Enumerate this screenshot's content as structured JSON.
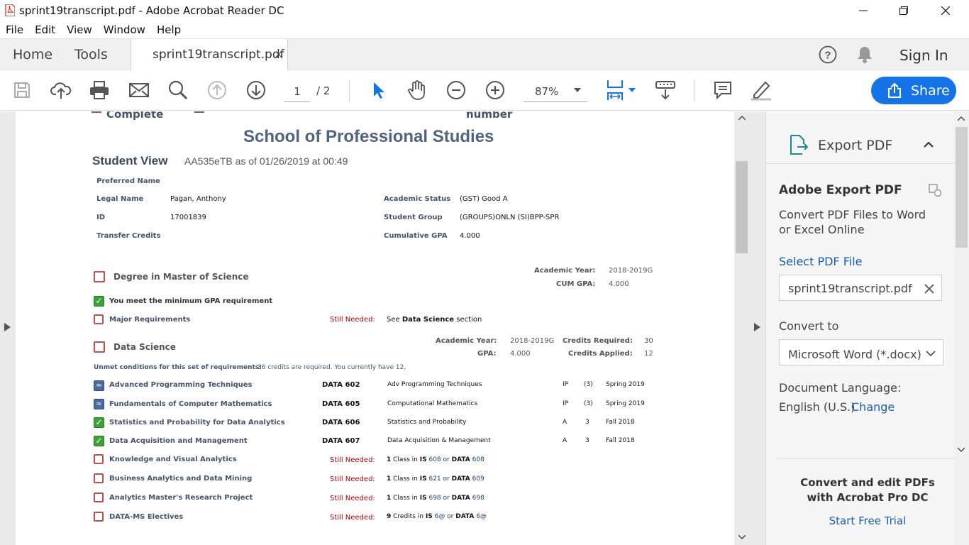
{
  "window": {
    "title": "sprint19transcript.pdf - Adobe Acrobat Reader DC",
    "minimize": "—",
    "maximize": "❐",
    "close": "✕"
  },
  "menu": [
    "File",
    "Edit",
    "View",
    "Window",
    "Help"
  ],
  "tabs": {
    "home": "Home",
    "tools": "Tools",
    "doc": "sprint19transcript.pdf",
    "doc_close": "×",
    "signin": "Sign In",
    "help_icon": "?"
  },
  "toolbar": {
    "page_current": "1",
    "page_total": "/ 2",
    "zoom": "87%",
    "share": "Share"
  },
  "document": {
    "cut_top_left": "Complete",
    "cut_top_right": "number",
    "school": "School of Professional Studies",
    "view_title": "Student View",
    "view_sub": "AA535eTB as of 01/26/2019 at 00:49",
    "info": {
      "preferred_name_label": "Preferred Name",
      "legal_name_label": "Legal Name",
      "legal_name": "Pagan, Anthony",
      "id_label": "ID",
      "id": "17001839",
      "transfer_label": "Transfer Credits",
      "status_label": "Academic Status",
      "status": "(GST) Good A",
      "group_label": "Student Group",
      "group": "(GROUPS)ONLN (SI)BPP-SPR",
      "gpa_label": "Cumulative GPA",
      "gpa": "4.000"
    },
    "degree": {
      "title": "Degree in Master of Science",
      "ay_label": "Academic Year:",
      "ay": "2018-2019G",
      "cumgpa_label": "CUM GPA:",
      "cumgpa": "4.000",
      "gpa_req": "You meet the minimum GPA requirement",
      "major": "Major Requirements",
      "still_needed": "Still Needed:",
      "major_note_pre": "See",
      "major_note_bold": "Data Science",
      "major_note_post": "section"
    },
    "ds": {
      "title": "Data Science",
      "ay_label": "Academic Year:",
      "ay": "2018-2019G",
      "gpa_label": "GPA:",
      "gpa": "4.000",
      "cr_req_label": "Credits Required:",
      "cr_req": "30",
      "cr_app_label": "Credits Applied:",
      "cr_app": "12",
      "unmet_label": "Unmet conditions for this set of requirements:",
      "unmet_text": "36 credits are required. You currently have 12,"
    },
    "courses": [
      {
        "name": "Advanced Programming Techniques",
        "code": "DATA 602",
        "title": "Adv Programming Techniques",
        "grade": "IP",
        "cr": "(3)",
        "term": "Spring 2019",
        "state": "ip"
      },
      {
        "name": "Fundamentals of Computer Mathematics",
        "code": "DATA 605",
        "title": "Computational Mathematics",
        "grade": "IP",
        "cr": "(3)",
        "term": "Spring 2019",
        "state": "ip"
      },
      {
        "name": "Statistics and Probability for Data Analytics",
        "code": "DATA 606",
        "title": "Statistics and Probability",
        "grade": "A",
        "cr": "3",
        "term": "Fall 2018",
        "state": "done"
      },
      {
        "name": "Data Acquisition and Management",
        "code": "DATA 607",
        "title": "Data Acquisition & Management",
        "grade": "A",
        "cr": "3",
        "term": "Fall 2018",
        "state": "done"
      }
    ],
    "needed": [
      {
        "name": "Knowledge and Visual Analytics",
        "sn": "Still Needed:",
        "n": "1",
        "txt1": "Class in",
        "s1": "IS",
        "v1": "608 or",
        "s2": "DATA",
        "v2": "608"
      },
      {
        "name": "Business Analytics and Data Mining",
        "sn": "Still Needed:",
        "n": "1",
        "txt1": "Class in",
        "s1": "IS",
        "v1": "621 or",
        "s2": "DATA",
        "v2": "609"
      },
      {
        "name": "Analytics Master's Research Project",
        "sn": "Still Needed:",
        "n": "1",
        "txt1": "Class in",
        "s1": "IS",
        "v1": "698 or",
        "s2": "DATA",
        "v2": "698"
      },
      {
        "name": "DATA-MS Electives",
        "sn": "Still Needed:",
        "n": "9",
        "txt1": "Credits in",
        "s1": "IS",
        "v1": "6@ or",
        "s2": "DATA",
        "v2": "6@"
      }
    ]
  },
  "panel": {
    "header": "Export PDF",
    "title": "Adobe Export PDF",
    "desc1": "Convert PDF Files to Word",
    "desc2": "or Excel Online",
    "select": "Select PDF File",
    "file": "sprint19transcript.pdf",
    "convert_to": "Convert to",
    "format": "Microsoft Word (*.docx)",
    "lang_label": "Document Language:",
    "lang": "English (U.S.)",
    "change": "Change",
    "promo1": "Convert and edit PDFs",
    "promo2": "with Acrobat Pro DC",
    "trial": "Start Free Trial"
  },
  "colors": {
    "accent": "#1473e6",
    "link": "#1a5fb4",
    "need": "#c00000",
    "label": "#44546a"
  }
}
